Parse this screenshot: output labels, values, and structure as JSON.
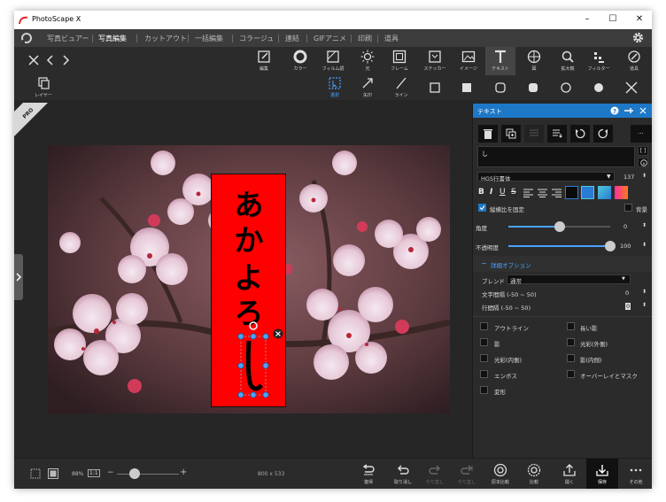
{
  "window": {
    "title": "PhotoScape X",
    "minimize": "–",
    "maximize": "☐",
    "close": "✕"
  },
  "menu": {
    "items": [
      {
        "label": "写真ビュアー",
        "active": false
      },
      {
        "label": "写真編集",
        "active": true
      },
      {
        "label": "カットアウト",
        "active": false
      },
      {
        "label": "一括編集",
        "active": false
      },
      {
        "label": "コラージュ",
        "active": false
      },
      {
        "label": "連結",
        "active": false
      },
      {
        "label": "GIFアニメ",
        "active": false
      },
      {
        "label": "印刷",
        "active": false
      },
      {
        "label": "道具",
        "active": false
      }
    ]
  },
  "tools": [
    {
      "label": "編集",
      "icon": "edit-icon"
    },
    {
      "label": "カラー",
      "icon": "color-icon"
    },
    {
      "label": "フィルム調",
      "icon": "film-icon"
    },
    {
      "label": "光",
      "icon": "light-icon"
    },
    {
      "label": "フレーム",
      "icon": "frame-icon"
    },
    {
      "label": "ステッカー",
      "icon": "sticker-icon"
    },
    {
      "label": "イメージ",
      "icon": "image-icon"
    },
    {
      "label": "テキスト",
      "icon": "text-icon"
    },
    {
      "label": "図",
      "icon": "shape-icon"
    },
    {
      "label": "拡大鏡",
      "icon": "magnifier-icon"
    },
    {
      "label": "フィルター",
      "icon": "filter-icon"
    },
    {
      "label": "道具",
      "icon": "tools-icon"
    }
  ],
  "subtools": {
    "layer_label": "レイヤー",
    "select_label": "選択",
    "arrow_label": "矢印",
    "line_label": "ライン"
  },
  "pro_badge": "PRO",
  "canvas": {
    "text_chars": [
      "あ",
      "か",
      "よ",
      "ろ"
    ],
    "cursor_char": "し"
  },
  "panel": {
    "title": "テキスト",
    "text_value": "し",
    "font_name": "HGS行書体",
    "font_size": "137",
    "fixed_ratio_label": "縦横比を固定",
    "background_label": "背景",
    "angle_label": "角度",
    "angle_value": "0",
    "angle_level": 0.5,
    "opacity_label": "不透明度",
    "opacity_value": "100",
    "opacity_level": 1.0,
    "advanced_label": "詳細オプション",
    "blend_label": "ブレンド",
    "blend_value": "通常",
    "char_spacing_label": "文字間隔 (-50 ~ 50)",
    "char_spacing_value": "0",
    "line_spacing_label": "行間隔 (-50 ~ 50)",
    "line_spacing_value": "0",
    "options": [
      {
        "label": "アウトライン"
      },
      {
        "label": "長い影"
      },
      {
        "label": "影"
      },
      {
        "label": "光彩(外側)"
      },
      {
        "label": "光彩(内側)"
      },
      {
        "label": "影(内側)"
      },
      {
        "label": "エンボス"
      },
      {
        "label": "オーバーレイとマスク"
      },
      {
        "label": "変形"
      }
    ],
    "colors": [
      "#2a7bd4",
      "#4fc9d8",
      "#ff2fa0",
      "#ff7a1a"
    ]
  },
  "bottom": {
    "zoom": "88%",
    "ratio_label": "1:1",
    "minus": "−",
    "plus": "+",
    "zoom_level": 0.28,
    "dimensions": "800 x 533",
    "buttons": [
      {
        "label": "復帰",
        "icon": "revert-icon",
        "disabled": false
      },
      {
        "label": "取り消し",
        "icon": "undo-icon",
        "disabled": false
      },
      {
        "label": "やり直し",
        "icon": "redo-icon",
        "disabled": true
      },
      {
        "label": "やり直し",
        "icon": "redo-all-icon",
        "disabled": true
      },
      {
        "label": "原本比較",
        "icon": "compare-icon",
        "disabled": false
      },
      {
        "label": "比較",
        "icon": "compare2-icon",
        "disabled": false
      },
      {
        "label": "開く",
        "icon": "open-icon",
        "disabled": false
      },
      {
        "label": "保存",
        "icon": "save-icon",
        "disabled": false
      },
      {
        "label": "その他",
        "icon": "more-icon",
        "disabled": false
      }
    ]
  }
}
